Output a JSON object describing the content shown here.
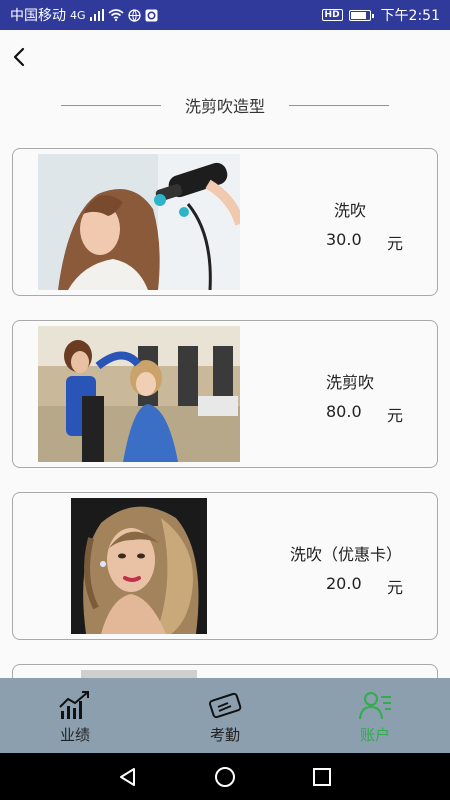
{
  "status_bar": {
    "carrier": "中国移动",
    "network": "4G",
    "hd": "HD",
    "time": "下午2:51",
    "battery_level": 0.75
  },
  "header": {
    "back_icon": "chevron-left-icon",
    "title": "洗剪吹造型"
  },
  "services": [
    {
      "name": "洗吹",
      "price": "30.0",
      "unit": "元",
      "image": "hairdryer-photo"
    },
    {
      "name": "洗剪吹",
      "price": "80.0",
      "unit": "元",
      "image": "salon-photo"
    },
    {
      "name": "洗吹（优惠卡）",
      "price": "20.0",
      "unit": "元",
      "image": "curly-hair-portrait"
    },
    {
      "name": "",
      "price": "",
      "unit": "",
      "image": "partial-photo"
    }
  ],
  "bottom_nav": {
    "items": [
      {
        "label": "业绩",
        "icon": "chart-trend-icon",
        "active": false
      },
      {
        "label": "考勤",
        "icon": "card-icon",
        "active": false
      },
      {
        "label": "账户",
        "icon": "user-list-icon",
        "active": true
      }
    ]
  },
  "colors": {
    "status_bar": "#2f3a9a",
    "bottom_nav": "#8b9fae",
    "active_tab": "#2fae4a"
  }
}
